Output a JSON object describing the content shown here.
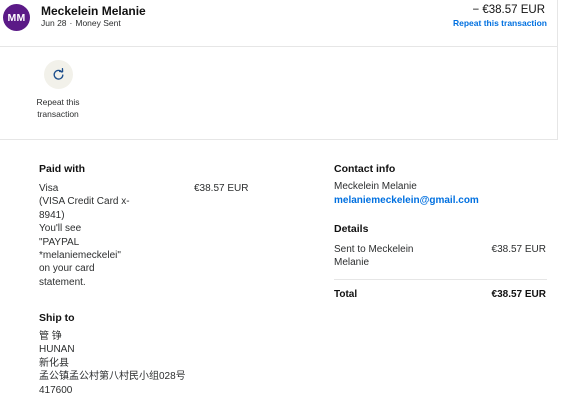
{
  "transaction": {
    "avatar_initials": "MM",
    "name": "Meckelein Melanie",
    "date": "Jun 28",
    "separator": "·",
    "type": "Money Sent",
    "amount": "− €38.57 EUR",
    "repeat_link": "Repeat this transaction"
  },
  "actions": {
    "repeat": {
      "icon": "refresh-icon",
      "label_line1": "Repeat this",
      "label_line2": "transaction"
    }
  },
  "paid_with": {
    "title": "Paid with",
    "lines": [
      "Visa",
      "(VISA Credit Card x-",
      "8941)",
      "You'll see",
      "\"PAYPAL",
      "*melaniemeckelei\"",
      "on your card",
      "statement."
    ],
    "amount": "€38.57 EUR"
  },
  "ship_to": {
    "title": "Ship to",
    "lines": [
      "管 铮",
      "HUNAN",
      "新化县",
      "孟公镇孟公村第八村民小组028号",
      "417600"
    ]
  },
  "contact_info": {
    "title": "Contact info",
    "name": "Meckelein Melanie",
    "email": "melaniemeckelein@gmail.com"
  },
  "details": {
    "title": "Details",
    "sent_to_line1": "Sent to Meckelein",
    "sent_to_line2": "Melanie",
    "sent_amount": "€38.57 EUR",
    "total_label": "Total",
    "total_amount": "€38.57 EUR"
  },
  "colors": {
    "avatar_bg": "#5b1a87",
    "link": "#0070e0",
    "action_bg": "#f2f1ea",
    "divider": "#e6e6e6"
  }
}
